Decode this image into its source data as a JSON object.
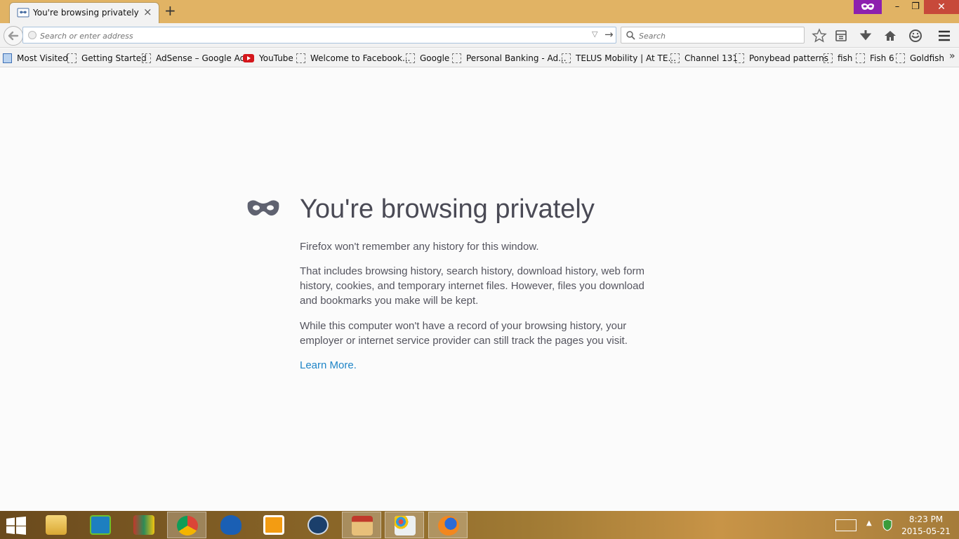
{
  "tab": {
    "title": "You're browsing privately",
    "close": "×"
  },
  "newtab": "+",
  "window": {
    "minimize": "–",
    "maximize": "❐",
    "close": "✕"
  },
  "urlbar": {
    "placeholder": "Search or enter address",
    "value": ""
  },
  "searchbar": {
    "placeholder": "Search",
    "value": ""
  },
  "bookmarks": [
    {
      "label": "Most Visited",
      "icon": "most-visited-icon"
    },
    {
      "label": "Getting Started",
      "icon": "page-icon"
    },
    {
      "label": "AdSense – Google Ads",
      "icon": "page-icon"
    },
    {
      "label": "YouTube",
      "icon": "youtube-icon"
    },
    {
      "label": "Welcome to Facebook...",
      "icon": "page-icon"
    },
    {
      "label": "Google",
      "icon": "page-icon"
    },
    {
      "label": "Personal Banking - Ad...",
      "icon": "page-icon"
    },
    {
      "label": "TELUS Mobility | At TE...",
      "icon": "page-icon"
    },
    {
      "label": "Channel 131",
      "icon": "page-icon"
    },
    {
      "label": "Ponybead patterns",
      "icon": "page-icon"
    },
    {
      "label": "fish",
      "icon": "page-icon"
    },
    {
      "label": "Fish 6",
      "icon": "page-icon"
    },
    {
      "label": "Goldfish",
      "icon": "page-icon"
    }
  ],
  "bookmarks_more": "»",
  "content": {
    "headline": "You're browsing privately",
    "p1": "Firefox won't remember any history for this window.",
    "p2": "That includes browsing history, search history, download history, web form history, cookies, and temporary internet files. However, files you download and bookmarks you make will be kept.",
    "p3": "While this computer won't have a record of your browsing history, your employer or internet service provider can still track the pages you visit.",
    "learn_more": "Learn More."
  },
  "taskbar": {
    "apps": [
      "file-explorer",
      "wps-writer",
      "winrar",
      "chrome",
      "malwarebytes",
      "media-player",
      "movie-maker",
      "library",
      "paint",
      "firefox"
    ],
    "active_app": "firefox",
    "time": "8:23 PM",
    "date": "2015-05-21"
  },
  "colors": {
    "titlebar": "#e1b364",
    "private_purple": "#8d20ae",
    "link": "#1f85c7",
    "headline": "#4a4a55"
  }
}
